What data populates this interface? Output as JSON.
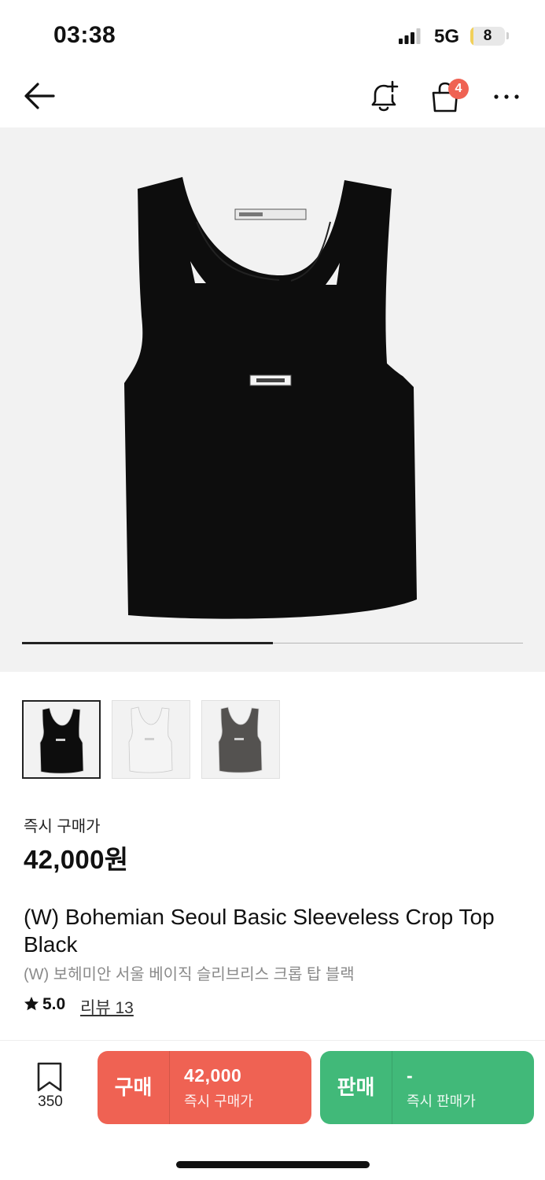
{
  "status_bar": {
    "time": "03:38",
    "network": "5G",
    "battery_level": "8",
    "battery_color": "#f1d05a"
  },
  "nav": {
    "back_icon": "arrow-left-icon",
    "alert_icon": "bell-plus-icon",
    "cart_icon": "shopping-bag-icon",
    "cart_count": "4",
    "more_icon": "more-horizontal-icon"
  },
  "gallery": {
    "slide_progress_percent": 50,
    "thumbnails": [
      {
        "color_name": "black",
        "swatch": "#0d0d0d",
        "selected": true
      },
      {
        "color_name": "white",
        "swatch": "#f4f4f4",
        "selected": false
      },
      {
        "color_name": "charcoal",
        "swatch": "#545250",
        "selected": false
      }
    ]
  },
  "price": {
    "label": "즉시 구매가",
    "value": "42,000원"
  },
  "product": {
    "title_en": "(W) Bohemian Seoul Basic Sleeveless Crop Top Black",
    "title_ko": "(W) 보헤미안 서울 베이직 슬리브리스 크롭 탑 블랙",
    "rating": "5.0",
    "review_label": "리뷰 13"
  },
  "action_bar": {
    "bookmark_count": "350",
    "buy": {
      "label": "구매",
      "price": "42,000",
      "sub": "즉시 구매가",
      "color": "#ef6253"
    },
    "sell": {
      "label": "판매",
      "price": "-",
      "sub": "즉시 판매가",
      "color": "#41b979"
    }
  }
}
